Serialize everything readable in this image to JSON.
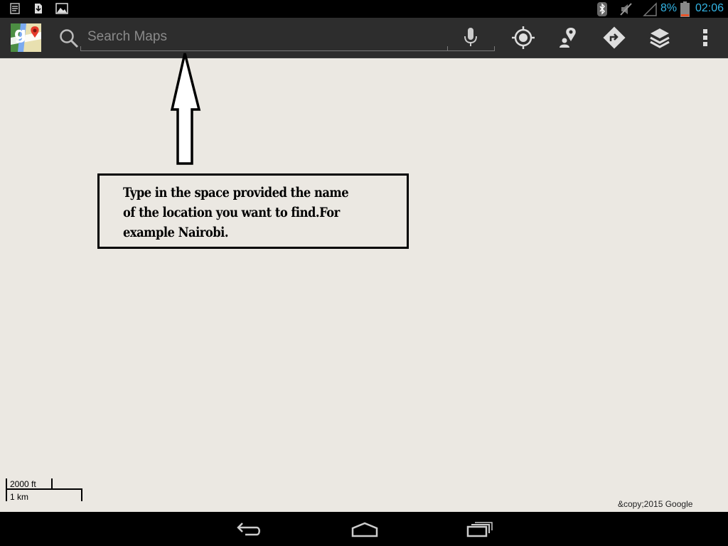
{
  "status_bar": {
    "battery_percent": "8%",
    "time": "02:06",
    "battery_level": 0.08,
    "accent_color": "#33b5e5",
    "icons": [
      "notes-icon",
      "download-icon",
      "image-icon",
      "bluetooth-icon",
      "mute-icon",
      "signal-icon",
      "battery-icon"
    ]
  },
  "action_bar": {
    "search_placeholder": "Search Maps",
    "search_value": "",
    "icons": [
      "maps-logo-icon",
      "search-icon",
      "microphone-icon",
      "my-location-icon",
      "local-place-icon",
      "directions-icon",
      "layers-icon",
      "overflow-menu-icon"
    ]
  },
  "annotation": {
    "instruction_text": "Type in the space provided the name of the location you want to find.For example Nairobi.",
    "lines": [
      "Type in the space provided the name",
      "of the location you want to find.For",
      "example Nairobi."
    ]
  },
  "map": {
    "scale_ft": "2000 ft",
    "scale_km": "1 km",
    "copyright": "&copy;2015 Google",
    "background_color": "#ebe8e2"
  },
  "nav_bar": {
    "icons": [
      "back-icon",
      "home-icon",
      "recent-apps-icon"
    ]
  }
}
